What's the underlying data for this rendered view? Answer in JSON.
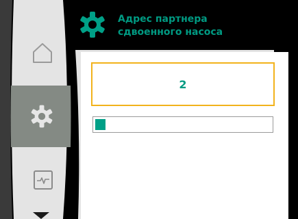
{
  "header": {
    "title_line1": "Адрес партнера",
    "title_line2": "сдвоенного насоса"
  },
  "sidebar": {
    "items": [
      {
        "name": "home",
        "icon": "home-icon",
        "active": false
      },
      {
        "name": "settings",
        "icon": "gear-icon",
        "active": true
      },
      {
        "name": "diagnostics",
        "icon": "pulse-chart-icon",
        "active": false
      }
    ],
    "scroll_indicator": "chevron-down-icon"
  },
  "main": {
    "value": "2",
    "progress_fraction": 0.06
  },
  "colors": {
    "accent": "#009a82",
    "focus_border": "#f2b21b",
    "progress_fill": "#00a087",
    "sidebar": "#e4e4e4",
    "sidebar_active": "#848a84",
    "background": "#000000"
  }
}
